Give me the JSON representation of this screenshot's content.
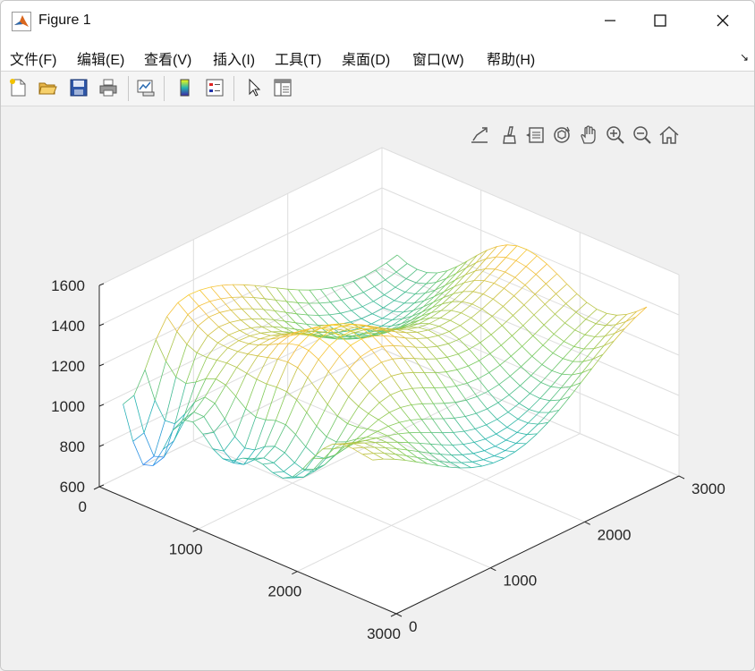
{
  "window": {
    "title": "Figure 1",
    "colors": {
      "titlebar": "#ffffff",
      "menubar": "#ffffff",
      "toolbar": "#f5f5f5",
      "figure": "#f0f0f0"
    }
  },
  "menu": {
    "items": [
      "文件(F)",
      "编辑(E)",
      "查看(V)",
      "插入(I)",
      "工具(T)",
      "桌面(D)",
      "窗口(W)",
      "帮助(H)"
    ]
  },
  "toolbar": {
    "buttons": [
      "new-figure-icon",
      "open-file-icon",
      "save-icon",
      "print-icon",
      "link-plot-icon",
      "colorbar-icon",
      "legend-icon",
      "pointer-icon",
      "property-inspector-icon"
    ]
  },
  "axes_toolbar": {
    "buttons": [
      "export-icon",
      "brush-icon",
      "data-tips-icon",
      "rotate-3d-icon",
      "pan-icon",
      "zoom-in-icon",
      "zoom-out-icon",
      "home-icon"
    ]
  },
  "chart_data": {
    "type": "surface-mesh",
    "colormap": "parula",
    "x_ticks": [
      "0",
      "1000",
      "2000",
      "3000"
    ],
    "y_ticks": [
      "0",
      "1000",
      "2000",
      "3000"
    ],
    "z_ticks": [
      "600",
      "800",
      "1000",
      "1200",
      "1400",
      "1600"
    ],
    "xlim": [
      0,
      3000
    ],
    "ylim": [
      0,
      3000
    ],
    "zlim": [
      600,
      1600
    ],
    "grid": true,
    "box": true
  }
}
